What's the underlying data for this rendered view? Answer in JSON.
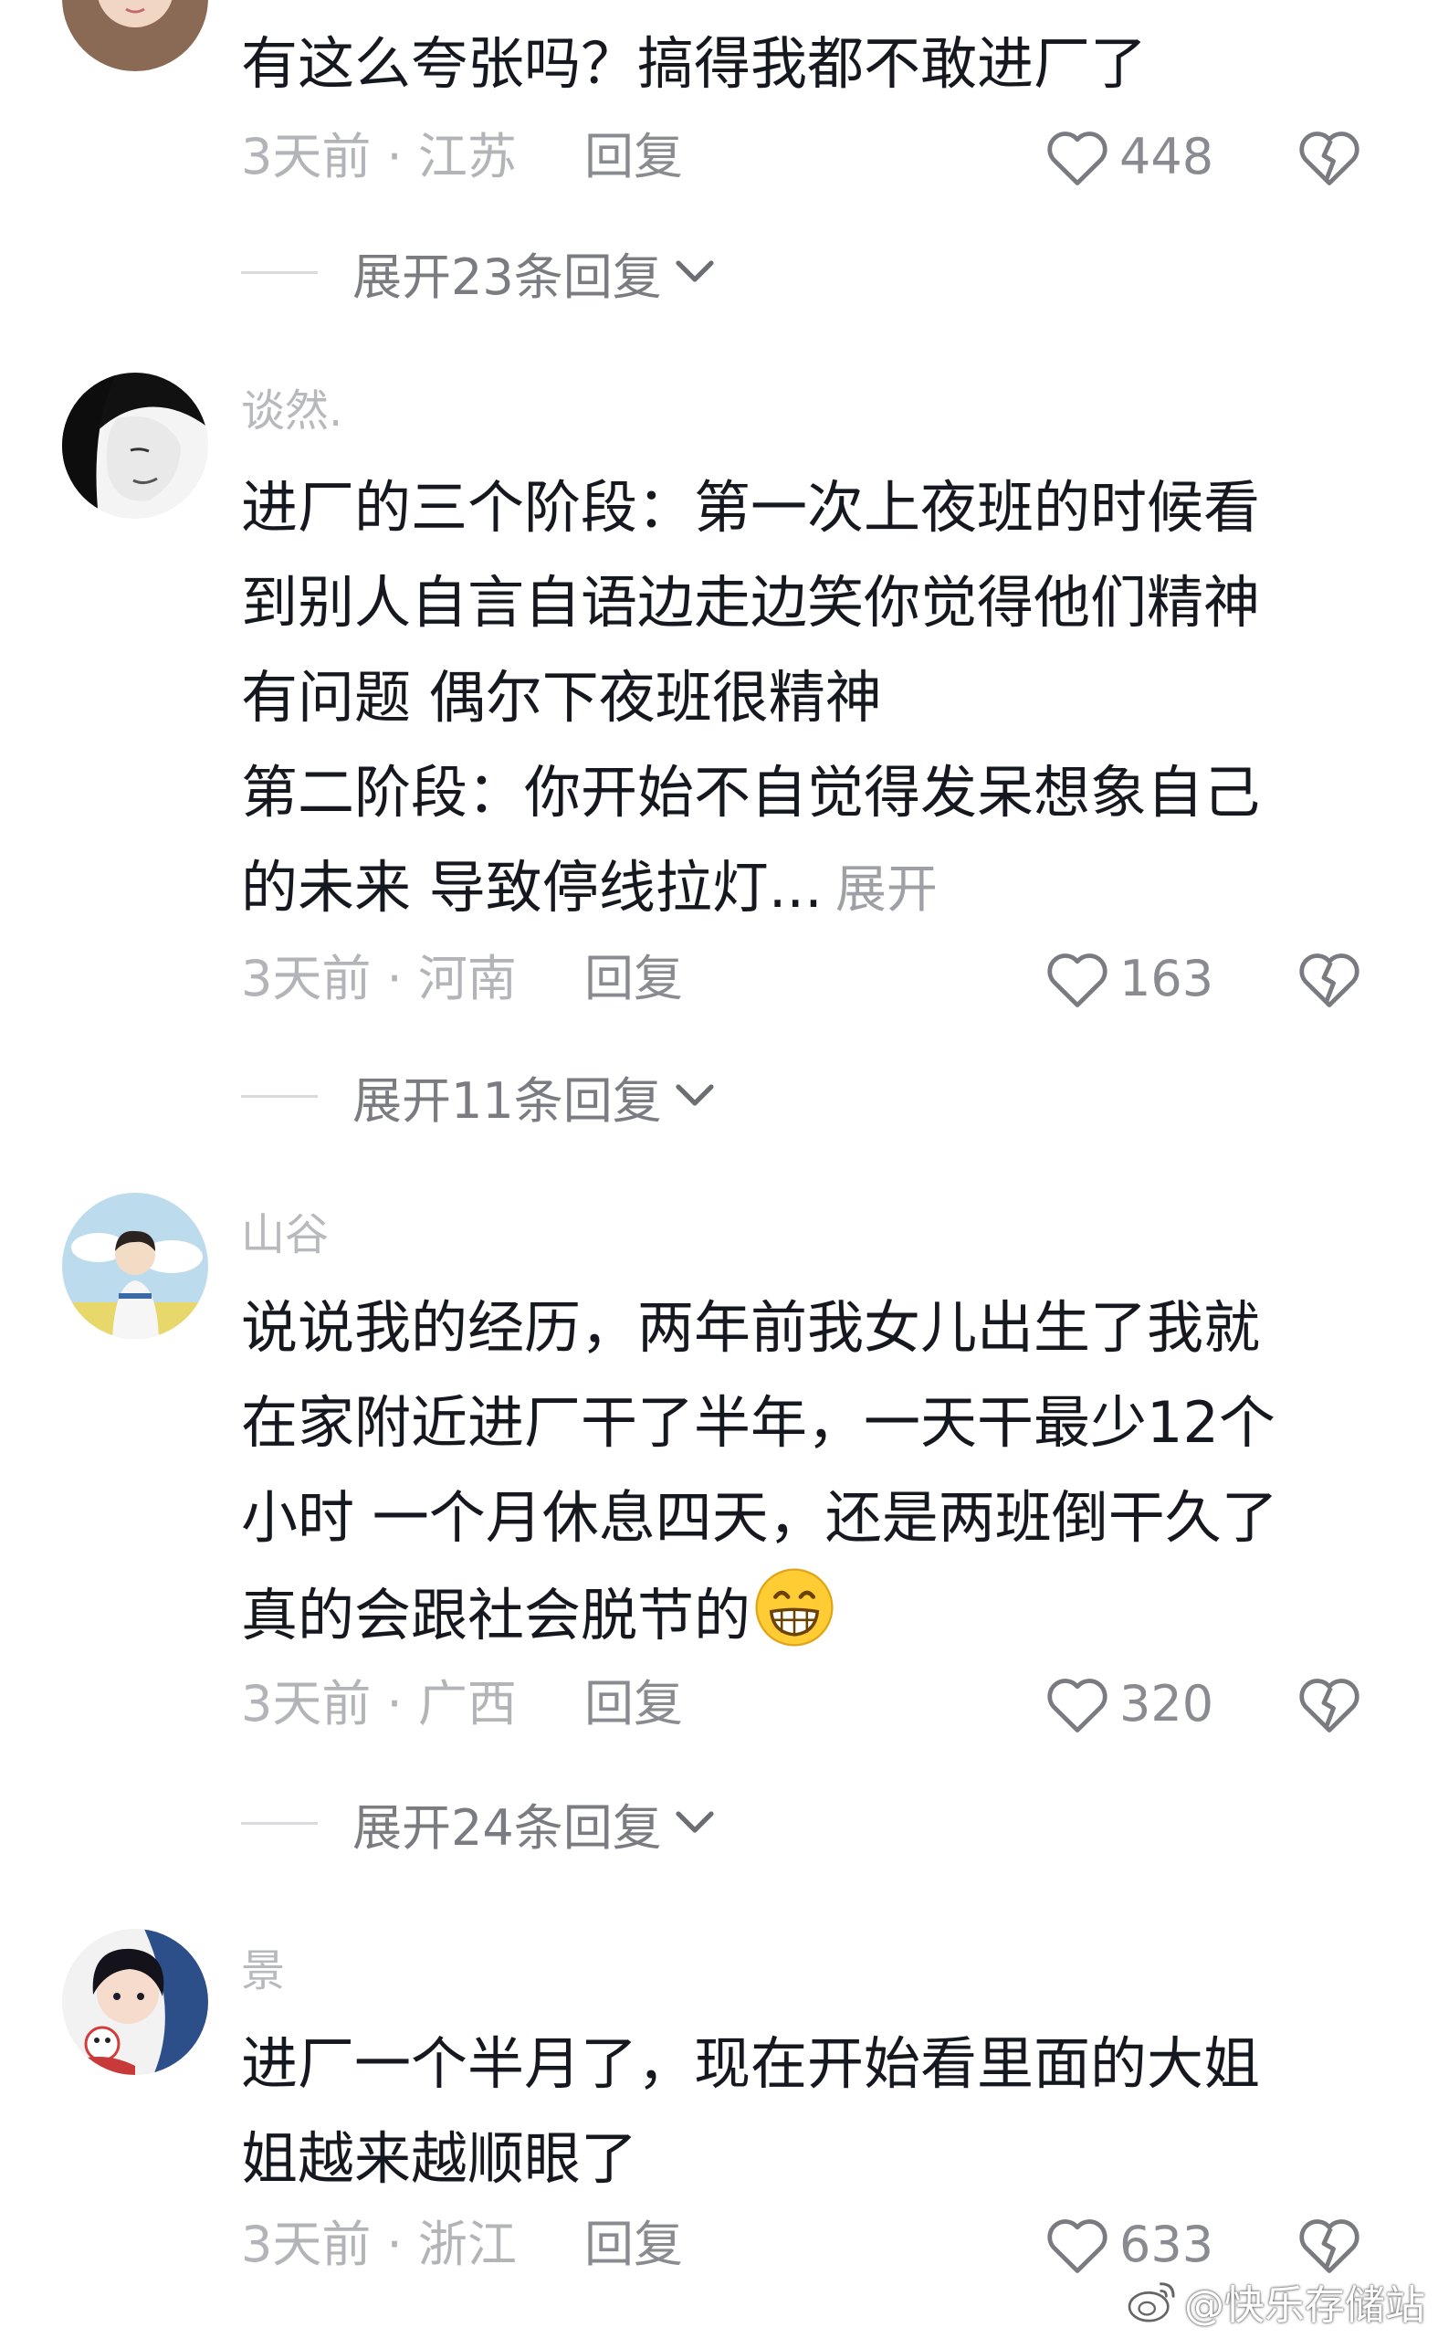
{
  "comments": [
    {
      "username": "",
      "lines": [
        "有这么夸张吗？搞得我都不敢进厂了"
      ],
      "expand_label": "",
      "time_location": "3天前 · 江苏",
      "reply_label": "回复",
      "likes": "448",
      "replies_label": "展开23条回复"
    },
    {
      "username": "谈然.",
      "lines": [
        "进厂的三个阶段：第一次上夜班的时候看",
        "到别人自言自语边走边笑你觉得他们精神",
        "有问题 偶尔下夜班很精神",
        "第二阶段：你开始不自觉得发呆想象自己",
        "的未来 导致停线拉灯..."
      ],
      "expand_label": "展开",
      "time_location": "3天前 · 河南",
      "reply_label": "回复",
      "likes": "163",
      "replies_label": "展开11条回复"
    },
    {
      "username": "山谷",
      "lines": [
        "说说我的经历，两年前我女儿出生了我就",
        "在家附近进厂干了半年，一天干最少12个",
        "小时 一个月休息四天，还是两班倒干久了",
        "真的会跟社会脱节的"
      ],
      "expand_label": "",
      "emoji": "grinning-face-emoji",
      "time_location": "3天前 · 广西",
      "reply_label": "回复",
      "likes": "320",
      "replies_label": "展开24条回复"
    },
    {
      "username": "景",
      "lines": [
        "进厂一个半月了，现在开始看里面的大姐",
        "姐越来越顺眼了"
      ],
      "expand_label": "",
      "time_location": "3天前 · 浙江",
      "reply_label": "回复",
      "likes": "633",
      "replies_label": ""
    }
  ],
  "watermark": "@快乐存储站",
  "icons": {
    "like": "heart-outline-icon",
    "dislike": "broken-heart-icon",
    "expand": "chevron-down-icon",
    "watermark": "weibo-logo-icon"
  }
}
